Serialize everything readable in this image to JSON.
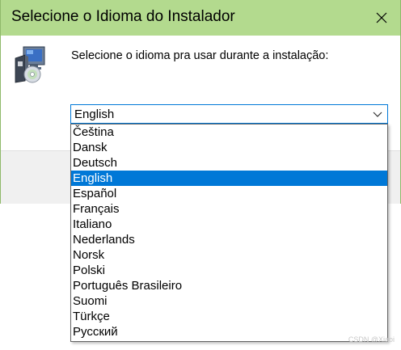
{
  "window": {
    "title": "Selecione o Idioma do Instalador",
    "close_icon": "close-icon",
    "colors": {
      "titlebar": "#b3da8e",
      "selection": "#0078d7",
      "accent_border": "#0078d7"
    }
  },
  "content": {
    "icon": "setup-installer-icon",
    "prompt": "Selecione o idioma pra usar durante a instalação:"
  },
  "language_select": {
    "selected_value": "English",
    "arrow_icon": "chevron-down-icon",
    "options": [
      "Čeština",
      "Dansk",
      "Deutsch",
      "English",
      "Español",
      "Français",
      "Italiano",
      "Nederlands",
      "Norsk",
      "Polski",
      "Português Brasileiro",
      "Suomi",
      "Türkçe",
      "Русский"
    ],
    "highlighted_index": 3
  },
  "watermark": "CSDN @Xiaoi"
}
